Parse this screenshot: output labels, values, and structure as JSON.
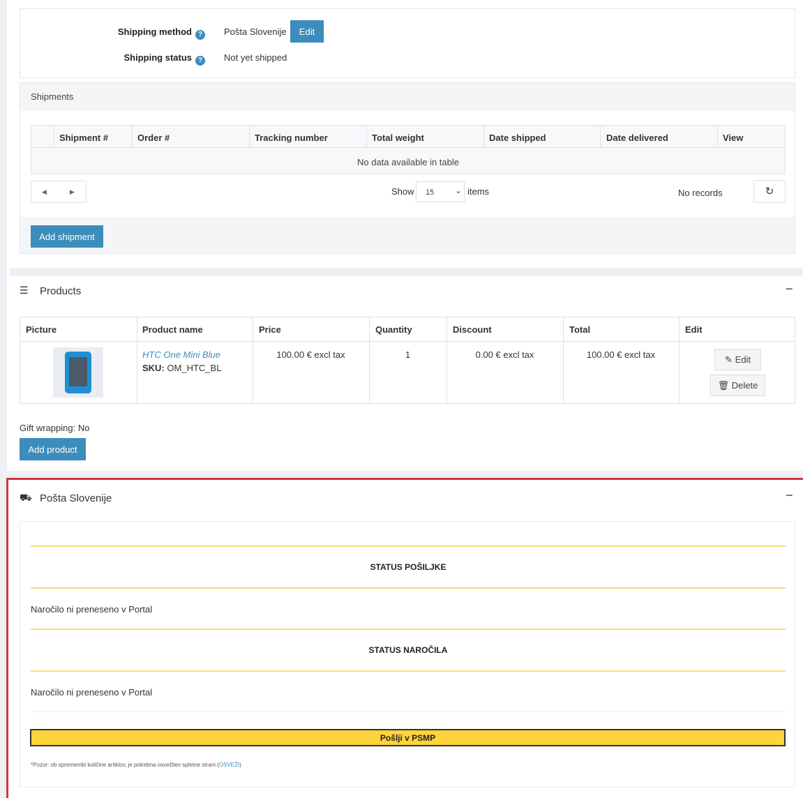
{
  "shipping": {
    "method_label": "Shipping method",
    "method_value": "Pošta Slovenije",
    "edit_label": "Edit",
    "status_label": "Shipping status",
    "status_value": "Not yet shipped"
  },
  "shipments": {
    "title": "Shipments",
    "columns": [
      "Shipment #",
      "Order #",
      "Tracking number",
      "Total weight",
      "Date shipped",
      "Date delivered",
      "View"
    ],
    "empty_text": "No data available in table",
    "show_label": "Show",
    "page_size": "15",
    "items_label": "items",
    "records_text": "No records",
    "add_label": "Add shipment"
  },
  "products": {
    "title": "Products",
    "columns": [
      "Picture",
      "Product name",
      "Price",
      "Quantity",
      "Discount",
      "Total",
      "Edit"
    ],
    "rows": [
      {
        "name": "HTC One Mini Blue",
        "sku_label": "SKU:",
        "sku": "OM_HTC_BL",
        "price": "100.00 € excl tax",
        "quantity": "1",
        "discount": "0.00 € excl tax",
        "total": "100.00 € excl tax",
        "edit_label": "Edit",
        "delete_label": "Delete"
      }
    ],
    "gift_wrapping": "Gift wrapping: No",
    "add_label": "Add product"
  },
  "posta": {
    "title": "Pošta Slovenije",
    "shipment_status_heading": "STATUS POŠILJKE",
    "shipment_status_text": "Naročilo ni preneseno v Portal",
    "order_status_heading": "STATUS NAROČILA",
    "order_status_text": "Naročilo ni preneseno v Portal",
    "send_label": "Pošlji v PSMP",
    "note_text": "*Pozor: ob spremembi količine artiklov, je potrebna osvežitev spletne strani (",
    "note_link": "OSVEŽI",
    "note_end": ")"
  },
  "colors": {
    "primary": "#3c8dbc",
    "highlight_border": "#d6343f",
    "send_button": "#fed43a",
    "yellow_rule": "#f6dc7e",
    "link": "#3c8dbc"
  }
}
